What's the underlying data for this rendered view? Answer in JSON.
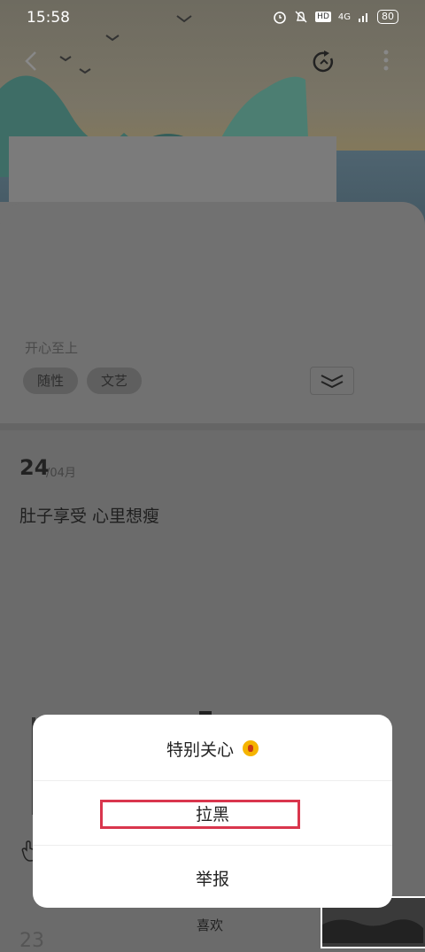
{
  "status_bar": {
    "time": "15:58",
    "network": "4G",
    "hd": "HD",
    "battery": "80"
  },
  "profile": {
    "bio": "开心至上",
    "tags": [
      "随性",
      "文艺"
    ]
  },
  "post": {
    "day": "24",
    "month_suffix": "/04月",
    "text": "肚子享受 心里想瘦"
  },
  "bottom": {
    "like_label": "喜欢",
    "partial_count": "23"
  },
  "action_sheet": {
    "items": [
      {
        "label": "特别关心",
        "icon": "crown-emoji-icon"
      },
      {
        "label": "拉黑"
      },
      {
        "label": "举报"
      }
    ],
    "highlight_color": "#d9364d"
  }
}
